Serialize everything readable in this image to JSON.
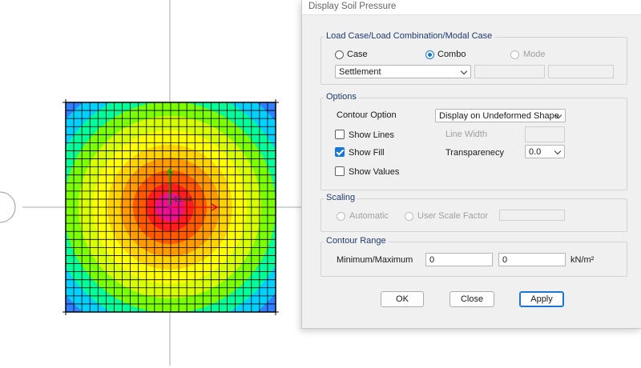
{
  "dialog": {
    "title": "Display Soil Pressure",
    "load_group": {
      "legend": "Load Case/Load Combination/Modal Case",
      "radio_case": "Case",
      "radio_combo": "Combo",
      "radio_mode": "Mode",
      "selected": "Combo",
      "combo_select_value": "Settlement"
    },
    "options_group": {
      "legend": "Options",
      "contour_option_label": "Contour Option",
      "contour_option_value": "Display on Undeformed Shape",
      "show_lines_label": "Show Lines",
      "show_lines_checked": false,
      "show_fill_label": "Show Fill",
      "show_fill_checked": true,
      "show_values_label": "Show Values",
      "show_values_checked": false,
      "line_width_label": "Line Width",
      "transparency_label": "Transparenecy",
      "transparency_value": "0.0"
    },
    "scaling_group": {
      "legend": "Scaling",
      "automatic_label": "Automatic",
      "user_scale_label": "User Scale Factor"
    },
    "contour_range_group": {
      "legend": "Contour Range",
      "minmax_label": "Minimum/Maximum",
      "min_value": "0",
      "max_value": "0",
      "units": "kN/m²"
    },
    "buttons": {
      "ok": "OK",
      "close": "Close",
      "apply": "Apply"
    }
  },
  "canvas": {
    "center_label": "18.44",
    "contour_colors": [
      "#2f7fff",
      "#00d2ff",
      "#00ff9a",
      "#7bff00",
      "#d8ff00",
      "#ffff00",
      "#ffd200",
      "#ff9a00",
      "#ff5a00",
      "#ff1e1e",
      "#e8128c"
    ]
  }
}
